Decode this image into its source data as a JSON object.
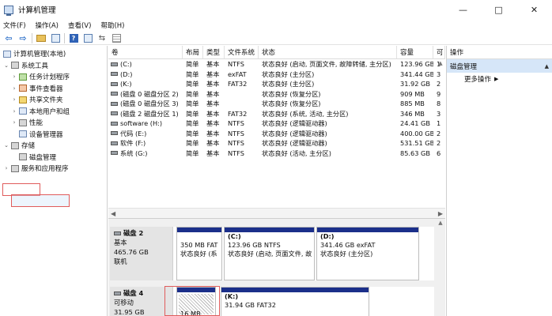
{
  "window": {
    "title": "计算机管理",
    "controls": [
      "—",
      "□",
      "✕"
    ]
  },
  "menu": [
    "文件(F)",
    "操作(A)",
    "查看(V)",
    "帮助(H)"
  ],
  "toolbar_icons": [
    "back-arrow-icon",
    "forward-arrow-icon",
    "folder-icon",
    "console-tree-icon",
    "help-icon",
    "console-icon",
    "connect-icon",
    "properties-icon"
  ],
  "tree": {
    "root": "计算机管理(本地)",
    "system_tools": "系统工具",
    "items": [
      "任务计划程序",
      "事件查看器",
      "共享文件夹",
      "本地用户和组",
      "性能",
      "设备管理器"
    ],
    "storage": "存储",
    "disk_management": "磁盘管理",
    "services": "服务和应用程序"
  },
  "volumes": {
    "headers": [
      "卷",
      "布局",
      "类型",
      "文件系统",
      "状态",
      "容量",
      "可"
    ],
    "rows": [
      [
        "(C:)",
        "简单",
        "基本",
        "NTFS",
        "状态良好 (启动, 页面文件, 故障转储, 主分区)",
        "123.96 GB",
        "1"
      ],
      [
        "(D:)",
        "简单",
        "基本",
        "exFAT",
        "状态良好 (主分区)",
        "341.44 GB",
        "3"
      ],
      [
        "(K:)",
        "简单",
        "基本",
        "FAT32",
        "状态良好 (主分区)",
        "31.92 GB",
        "2"
      ],
      [
        "(磁盘 0 磁盘分区 2)",
        "简单",
        "基本",
        "",
        "状态良好 (恢复分区)",
        "909 MB",
        "9"
      ],
      [
        "(磁盘 0 磁盘分区 3)",
        "简单",
        "基本",
        "",
        "状态良好 (恢复分区)",
        "885 MB",
        "8"
      ],
      [
        "(磁盘 2 磁盘分区 1)",
        "简单",
        "基本",
        "FAT32",
        "状态良好 (系统, 活动, 主分区)",
        "346 MB",
        "3"
      ],
      [
        "software (H:)",
        "简单",
        "基本",
        "NTFS",
        "状态良好 (逻辑驱动器)",
        "24.41 GB",
        "1"
      ],
      [
        "代码 (E:)",
        "简单",
        "基本",
        "NTFS",
        "状态良好 (逻辑驱动器)",
        "400.00 GB",
        "2"
      ],
      [
        "软件 (F:)",
        "简单",
        "基本",
        "NTFS",
        "状态良好 (逻辑驱动器)",
        "531.51 GB",
        "2"
      ],
      [
        "系统 (G:)",
        "简单",
        "基本",
        "NTFS",
        "状态良好 (活动, 主分区)",
        "85.63 GB",
        "6"
      ]
    ]
  },
  "disks": [
    {
      "name": "磁盘 2",
      "kind": "基本",
      "size": "465.76 GB",
      "status": "联机",
      "partitions": [
        {
          "title": "",
          "line1": "350 MB FAT",
          "line2": "状态良好 (系"
        },
        {
          "title": "(C:)",
          "line1": "123.96 GB NTFS",
          "line2": "状态良好 (启动, 页面文件, 故"
        },
        {
          "title": "(D:)",
          "line1": "341.46 GB exFAT",
          "line2": "状态良好 (主分区)"
        }
      ]
    },
    {
      "name": "磁盘 4",
      "kind": "可移动",
      "size": "31.95 GB",
      "status": "",
      "partitions": [
        {
          "title": "",
          "line1": "16 MB",
          "line2": ""
        },
        {
          "title": "(K:)",
          "line1": "31.94 GB FAT32",
          "line2": ""
        }
      ]
    }
  ],
  "actions": {
    "header": "操作",
    "section": "磁盘管理",
    "more": "更多操作"
  },
  "colors": {
    "partition_bar": "#1b2f8a",
    "selection_outline": "#e05b5b",
    "action_section_bg": "#d6e6f8"
  }
}
